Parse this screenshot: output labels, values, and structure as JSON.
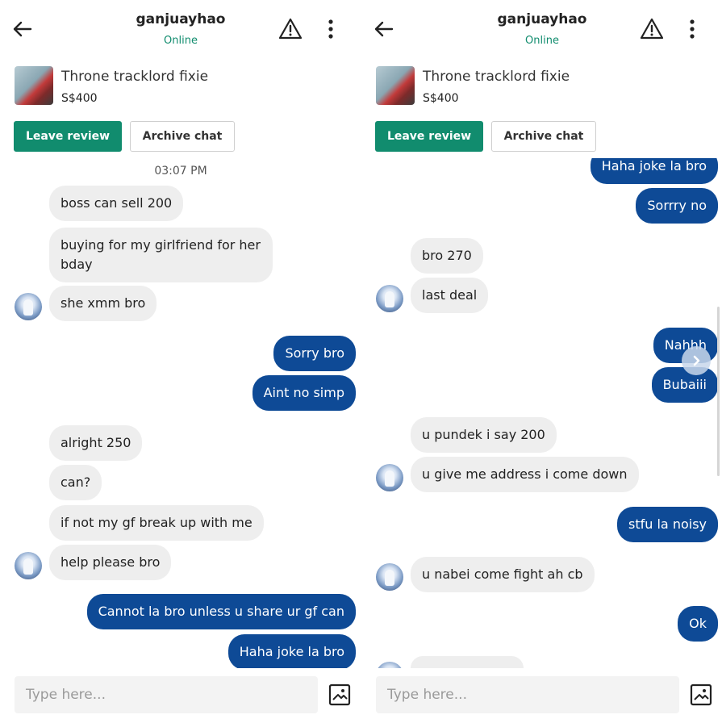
{
  "chat": {
    "username": "ganjuayhao",
    "status": "Online",
    "listing_title": "Throne tracklord fixie",
    "listing_price": "S$400",
    "leave_review": "Leave review",
    "archive_chat": "Archive chat",
    "placeholder": "Type here..."
  },
  "icons": {
    "back": "arrow-left-icon",
    "warning": "warning-triangle-icon",
    "more": "more-vertical-icon",
    "attach": "image-attach-icon",
    "jump": "chevron-right-icon"
  },
  "colors": {
    "accent": "#118c6e",
    "outgoing_bubble": "#0e4a96",
    "incoming_bubble": "#eeeeee"
  },
  "left": {
    "timestamp": "03:07 PM",
    "messages": [
      {
        "dir": "in",
        "text": "boss can sell 200"
      },
      {
        "dir": "in",
        "text": "buying for my girlfriend for her bday"
      },
      {
        "dir": "in",
        "text": "she xmm bro"
      },
      {
        "dir": "out",
        "text": "Sorry bro"
      },
      {
        "dir": "out",
        "text": "Aint no simp"
      },
      {
        "dir": "in",
        "text": "alright 250"
      },
      {
        "dir": "in",
        "text": "can?"
      },
      {
        "dir": "in",
        "text": "if not my gf break up with me"
      },
      {
        "dir": "in",
        "text": "help please bro"
      },
      {
        "dir": "out",
        "text": "Cannot la bro unless u share ur gf can"
      },
      {
        "dir": "out",
        "text": "Haha joke la bro"
      }
    ]
  },
  "right": {
    "messages": [
      {
        "dir": "out",
        "text": "Haha joke la bro"
      },
      {
        "dir": "out",
        "text": "Sorrry no"
      },
      {
        "dir": "in",
        "text": "bro 270"
      },
      {
        "dir": "in",
        "text": "last deal"
      },
      {
        "dir": "out",
        "text": "Nahhh"
      },
      {
        "dir": "out",
        "text": "Bubaiii"
      },
      {
        "dir": "in",
        "text": "u pundek i say 200"
      },
      {
        "dir": "in",
        "text": "u give me address i come down"
      },
      {
        "dir": "out",
        "text": "stfu la noisy"
      },
      {
        "dir": "in",
        "text": "u nabei come fight ah cb"
      },
      {
        "dir": "out",
        "text": "Ok"
      }
    ]
  }
}
